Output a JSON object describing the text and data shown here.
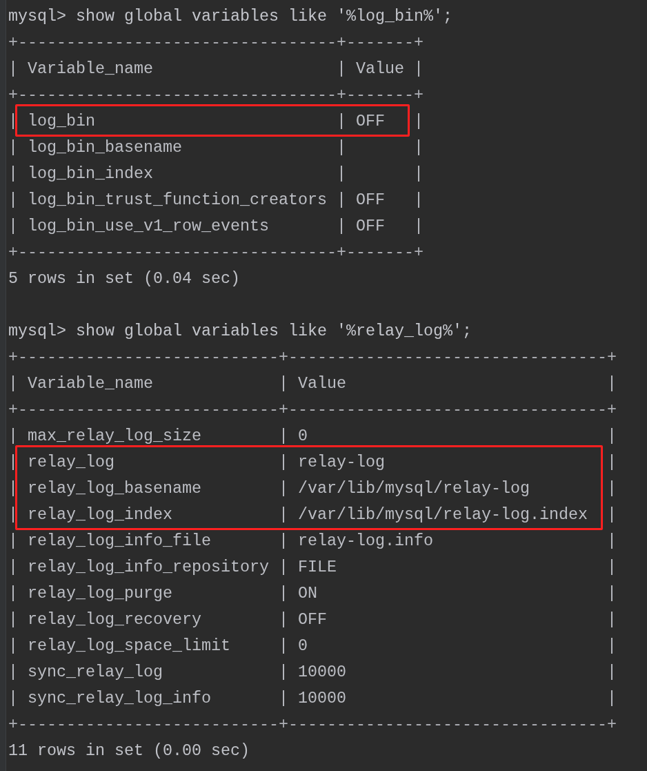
{
  "lines": [
    {
      "kind": "command",
      "text": "mysql> show global variables like '%log_bin%';",
      "highlighted": false
    },
    {
      "kind": "border",
      "text": "+---------------------------------+-------+",
      "highlighted": false
    },
    {
      "kind": "header",
      "text": "| Variable_name                   | Value |",
      "highlighted": false
    },
    {
      "kind": "border",
      "text": "+---------------------------------+-------+",
      "highlighted": false
    },
    {
      "kind": "row",
      "text": "| log_bin                         | OFF   |",
      "highlighted": true
    },
    {
      "kind": "row",
      "text": "| log_bin_basename                |       |",
      "highlighted": false
    },
    {
      "kind": "row",
      "text": "| log_bin_index                   |       |",
      "highlighted": false
    },
    {
      "kind": "row",
      "text": "| log_bin_trust_function_creators | OFF   |",
      "highlighted": false
    },
    {
      "kind": "row",
      "text": "| log_bin_use_v1_row_events       | OFF   |",
      "highlighted": false
    },
    {
      "kind": "border",
      "text": "+---------------------------------+-------+",
      "highlighted": false
    },
    {
      "kind": "summary",
      "text": "5 rows in set (0.04 sec)",
      "highlighted": false
    },
    {
      "kind": "blank"
    },
    {
      "kind": "command",
      "text": "mysql> show global variables like '%relay_log%';",
      "highlighted": false
    },
    {
      "kind": "border",
      "text": "+---------------------------+---------------------------------+",
      "highlighted": false
    },
    {
      "kind": "header",
      "text": "| Variable_name             | Value                           |",
      "highlighted": false
    },
    {
      "kind": "border",
      "text": "+---------------------------+---------------------------------+",
      "highlighted": false
    },
    {
      "kind": "row",
      "text": "| max_relay_log_size        | 0                               |",
      "highlighted": false
    },
    {
      "kind": "row",
      "text": "| relay_log                 | relay-log                       |",
      "highlighted": true
    },
    {
      "kind": "row",
      "text": "| relay_log_basename        | /var/lib/mysql/relay-log        |",
      "highlighted": true
    },
    {
      "kind": "row",
      "text": "| relay_log_index           | /var/lib/mysql/relay-log.index  |",
      "highlighted": true
    },
    {
      "kind": "row",
      "text": "| relay_log_info_file       | relay-log.info                  |",
      "highlighted": false
    },
    {
      "kind": "row",
      "text": "| relay_log_info_repository | FILE                            |",
      "highlighted": false
    },
    {
      "kind": "row",
      "text": "| relay_log_purge           | ON                              |",
      "highlighted": false
    },
    {
      "kind": "row",
      "text": "| relay_log_recovery        | OFF                             |",
      "highlighted": false
    },
    {
      "kind": "row",
      "text": "| relay_log_space_limit     | 0                               |",
      "highlighted": false
    },
    {
      "kind": "row",
      "text": "| sync_relay_log            | 10000                           |",
      "highlighted": false
    },
    {
      "kind": "row",
      "text": "| sync_relay_log_info       | 10000                           |",
      "highlighted": false
    },
    {
      "kind": "border",
      "text": "+---------------------------+---------------------------------+",
      "highlighted": false
    },
    {
      "kind": "summary",
      "text": "11 rows in set (0.00 sec)",
      "highlighted": false
    }
  ]
}
